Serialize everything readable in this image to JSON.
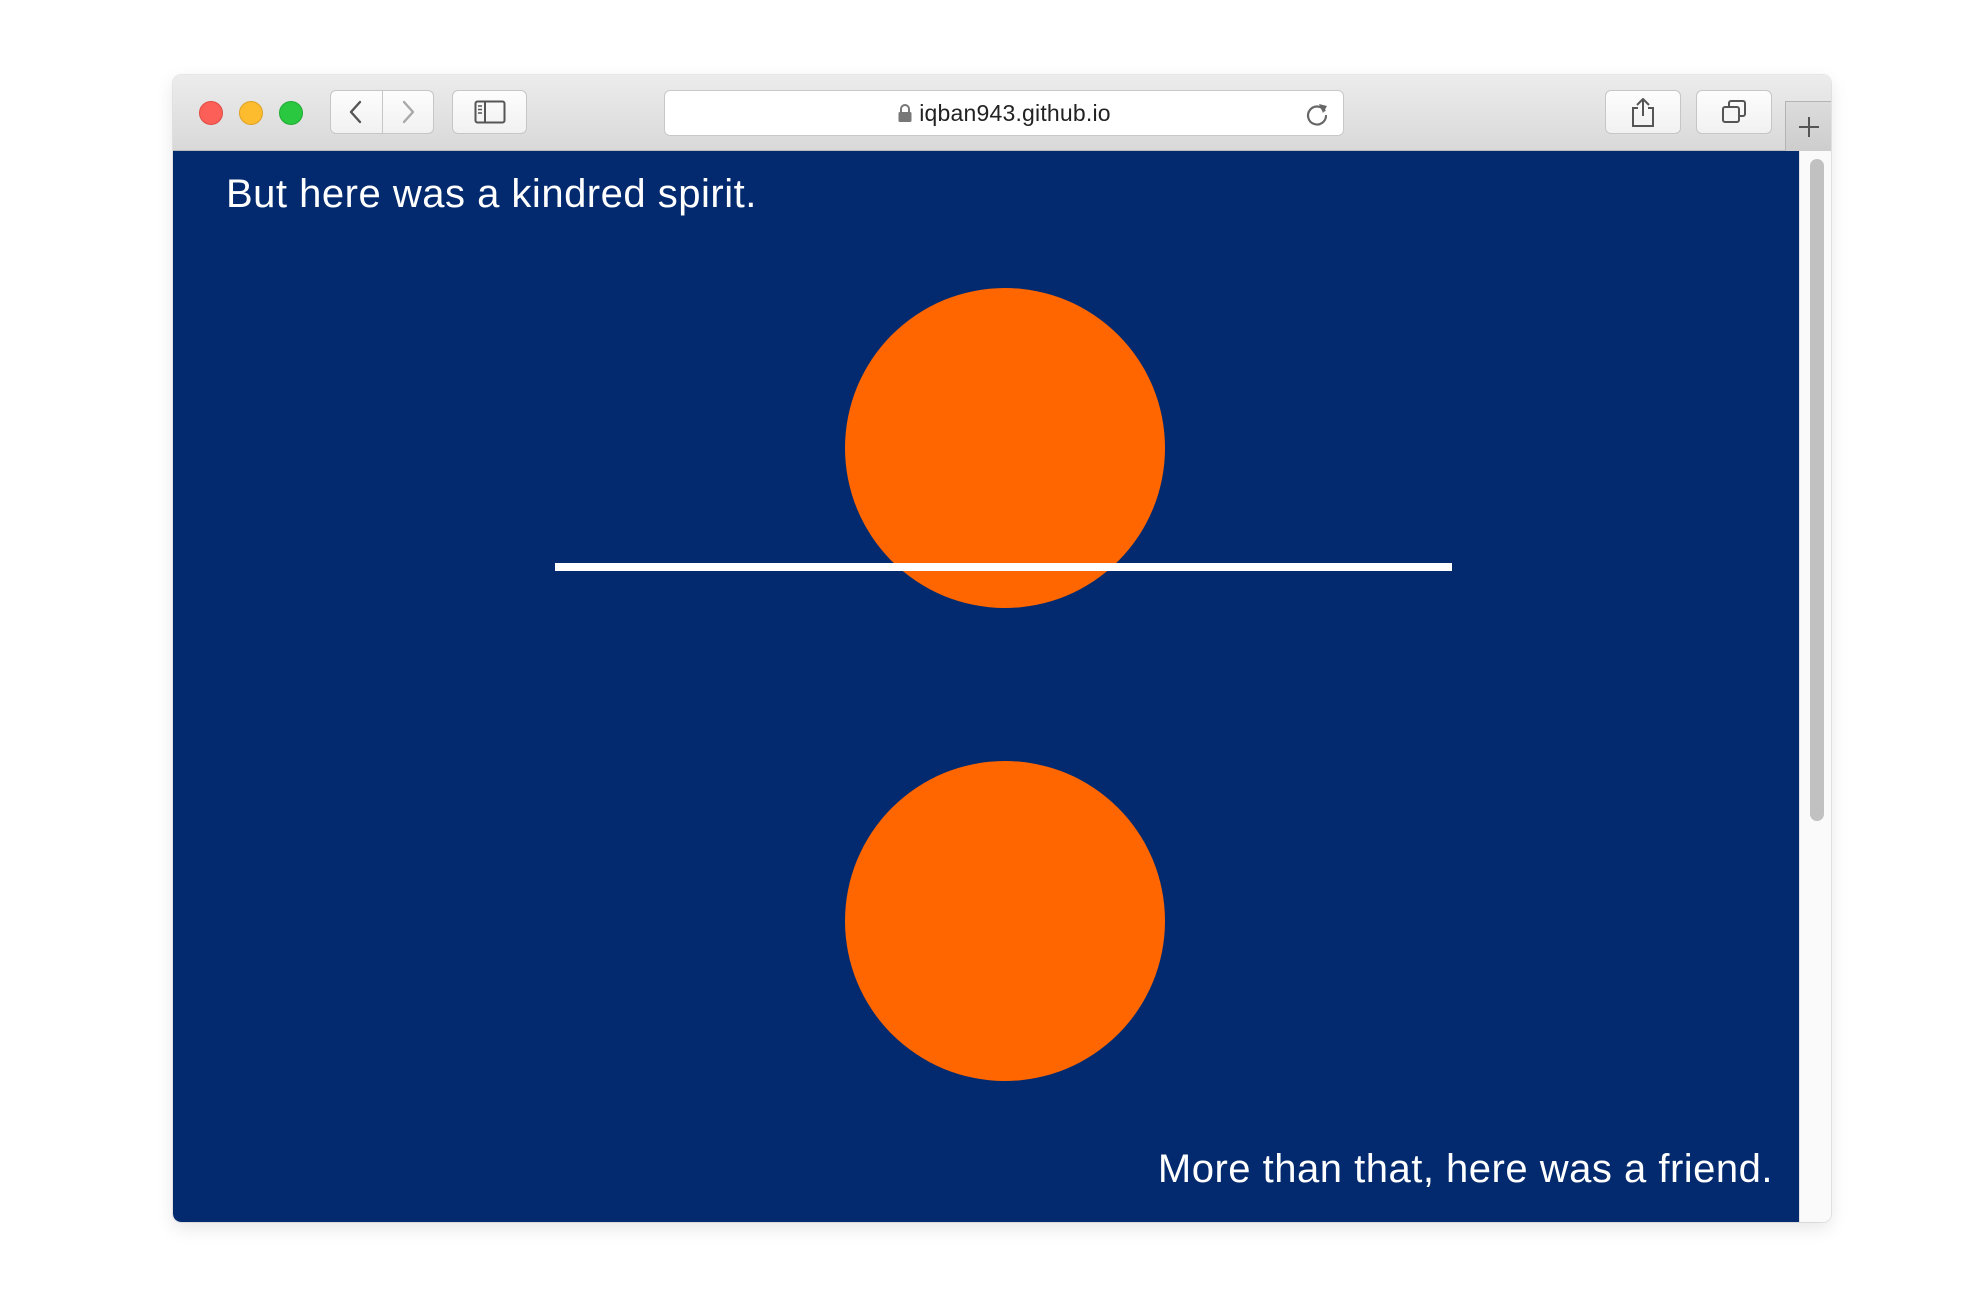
{
  "browser": {
    "url": "iqban943.github.io",
    "new_tab_symbol": "+",
    "icons": {
      "close": "close-window-icon",
      "minimize": "minimize-window-icon",
      "maximize": "maximize-window-icon",
      "back": "chevron-left-icon",
      "forward": "chevron-right-icon",
      "sidebar": "sidebar-icon",
      "lock": "lock-icon",
      "reload": "reload-icon",
      "share": "share-icon",
      "tabs": "tabs-overview-icon",
      "new_tab": "plus-icon"
    }
  },
  "page": {
    "top_text": "But here was a kindred spirit.",
    "bottom_text": "More than that, here was a friend.",
    "colors": {
      "background": "#032a6e",
      "circle": "#ff6600",
      "text": "#ffffff",
      "divider": "#ffffff"
    }
  }
}
